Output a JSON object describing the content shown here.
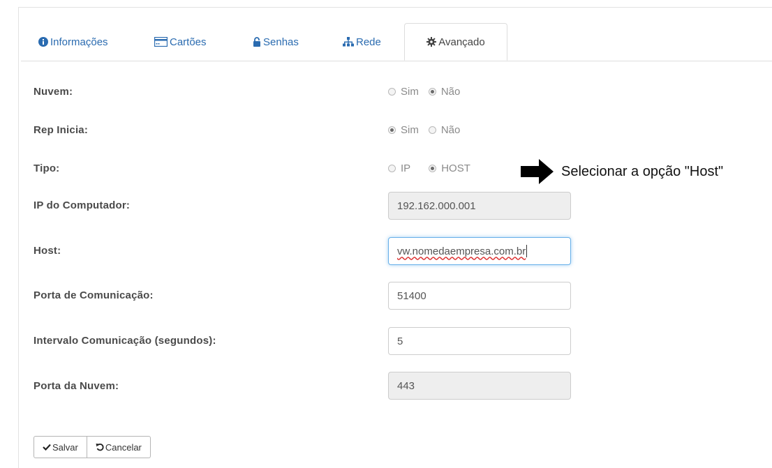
{
  "tabs": [
    {
      "label": "Informações",
      "icon": "info-circle-icon"
    },
    {
      "label": "Cartões",
      "icon": "card-icon"
    },
    {
      "label": "Senhas",
      "icon": "lock-icon"
    },
    {
      "label": "Rede",
      "icon": "sitemap-icon"
    },
    {
      "label": "Avançado",
      "icon": "gear-icon",
      "active": true
    }
  ],
  "form": {
    "nuvem": {
      "label": "Nuvem:",
      "options": [
        "Sim",
        "Não"
      ],
      "selected": "Não"
    },
    "rep_inicia": {
      "label": "Rep Inicia:",
      "options": [
        "Sim",
        "Não"
      ],
      "selected": "Sim"
    },
    "tipo": {
      "label": "Tipo:",
      "options": [
        "IP",
        "HOST"
      ],
      "selected": "HOST"
    },
    "ip": {
      "label": "IP do Computador:",
      "value": "192.162.000.001"
    },
    "host": {
      "label": "Host:",
      "value": "vw.nomedaempresa.com.br"
    },
    "porta": {
      "label": "Porta de Comunicação:",
      "value": "51400"
    },
    "intervalo": {
      "label": "Intervalo Comunicação (segundos):",
      "value": "5"
    },
    "porta_nuvem": {
      "label": "Porta da Nuvem:",
      "value": "443"
    }
  },
  "annotation": {
    "text": "Selecionar a opção \"Host\""
  },
  "buttons": {
    "save": "Salvar",
    "cancel": "Cancelar"
  },
  "colors": {
    "link": "#2a6bb0",
    "focus": "#66afe9"
  }
}
